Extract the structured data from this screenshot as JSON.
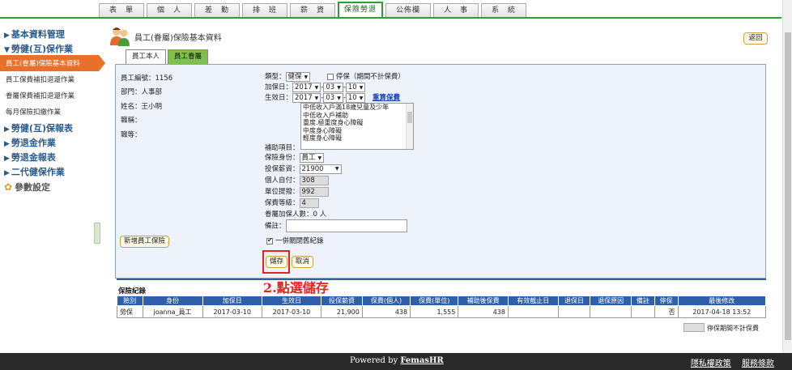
{
  "top_tabs": [
    "表　單",
    "個　人",
    "差　勤",
    "排　班",
    "薪　資",
    "保險勞退",
    "公佈欄",
    "人　事",
    "系　統"
  ],
  "active_tab_index": 5,
  "sidebar": {
    "sections": [
      {
        "label": "基本資料管理"
      },
      {
        "label": "勞健(互)保作業"
      }
    ],
    "items": [
      "員工(眷屬)保險基本資料",
      "員工保費補扣退還作業",
      "眷屬保費補扣退還作業",
      "每月保險扣繳作業"
    ],
    "sections2": [
      "勞健(互)保報表",
      "勞退金作業",
      "勞退金報表",
      "二代健保作業"
    ],
    "param_label": "參數設定"
  },
  "page": {
    "title": "員工(眷屬)保險基本資料",
    "back_label": "返回",
    "subtabs": [
      "員工本人",
      "員工眷屬"
    ]
  },
  "employee": {
    "id_label": "員工編號：1156",
    "dept_label": "部門：人事部",
    "name_label": "姓名：王小明",
    "title_label": "職稱：",
    "grade_label": "職等："
  },
  "form": {
    "type_label": "類型：",
    "type_value": "健保",
    "suspend_label": "停保（期間不計保費）",
    "insured_date_label": "加保日：",
    "insured_year": "2017",
    "insured_month": "03",
    "insured_day": "10",
    "effective_date_label": "生效日：",
    "effective_year": "2017",
    "effective_month": "03",
    "effective_day": "10",
    "recalc_link": "重算保費",
    "subsidy_options": [
      "中低收入戶滿18歲兒童及少年",
      "中低收入戶補助",
      "重度.極重度身心障礙",
      "中度身心障礙",
      "輕度身心障礙"
    ],
    "subsidy_label": "補助項目：",
    "identity_label": "保險身份：",
    "identity_value": "員工",
    "salary_label": "投保薪資：",
    "salary_value": "21900",
    "self_pay_label": "個人自付：",
    "self_pay_value": "308",
    "unit_pay_label": "單位提撥：",
    "unit_pay_value": "992",
    "grade_label": "保費等級：",
    "grade_value": "4",
    "dependents_label": "眷屬加保人數：0 人",
    "note_label": "備註：",
    "close_record_label": "一併關閉舊紀錄",
    "new_insurance_button": "新增員工保險",
    "save_button": "儲存",
    "cancel_button": "取消"
  },
  "annotation": "2.點選儲存",
  "records": {
    "title": "保險紀錄",
    "columns": [
      "險別",
      "身份",
      "加保日",
      "生效日",
      "投保薪資",
      "保費(個人)",
      "保費(單位)",
      "補助後保費",
      "有效截止日",
      "退保日",
      "退保原因",
      "備註",
      "停保",
      "最後修改"
    ],
    "rows": [
      [
        "勞保",
        "joanna_員工",
        "2017-03-10",
        "2017-03-10",
        "21,900",
        "438",
        "1,555",
        "438",
        "",
        "",
        "",
        "",
        "否",
        "2017-04-18 13:52"
      ]
    ],
    "legend": "停保期間不計保費"
  },
  "footer": {
    "powered_prefix": "Powered by ",
    "powered_brand": "FemasHR",
    "privacy": "隱私權政策",
    "terms": "服務條款"
  }
}
